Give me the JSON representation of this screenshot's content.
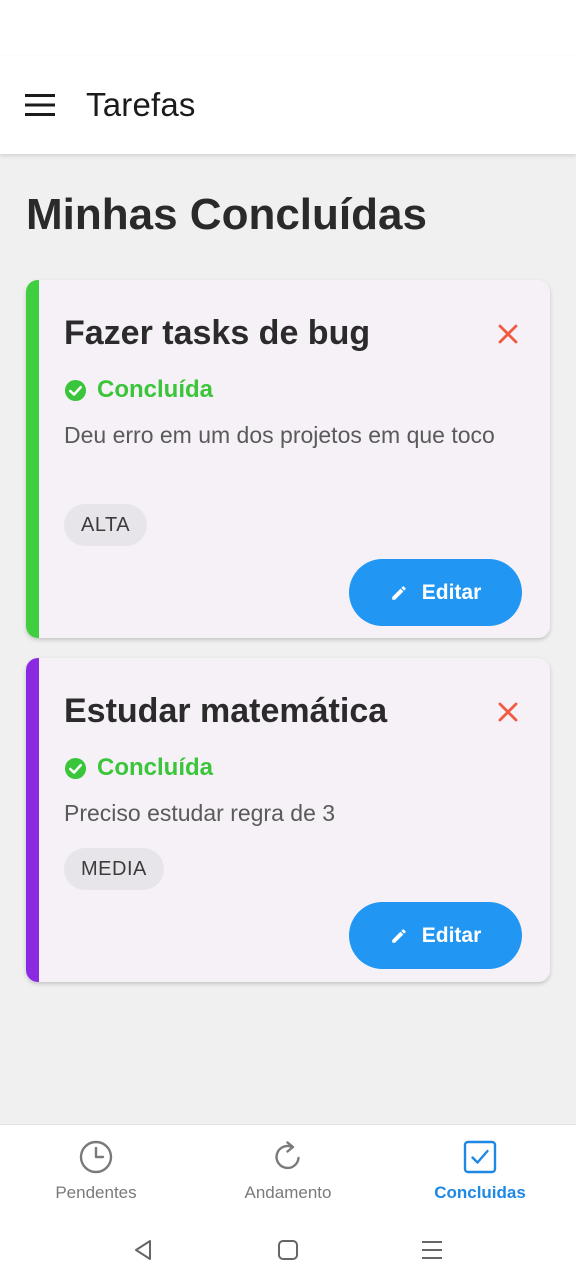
{
  "appbar": {
    "title": "Tarefas"
  },
  "page": {
    "title": "Minhas Concluídas"
  },
  "colors": {
    "primary": "#2196f3",
    "done": "#3ac53a",
    "close": "#f15a40",
    "accent_high": "#3fce3f",
    "accent_medium": "#8a2be2",
    "nav_active": "#1e88e5"
  },
  "tasks": [
    {
      "title": "Fazer tasks de bug",
      "status": "Concluída",
      "description": "Deu erro em um dos projetos em que toco",
      "priority": "ALTA",
      "edit_label": "Editar"
    },
    {
      "title": "Estudar matemática",
      "status": "Concluída",
      "description": "Preciso estudar regra de 3",
      "priority": "MEDIA",
      "edit_label": "Editar"
    }
  ],
  "bottom_nav": {
    "items": [
      {
        "label": "Pendentes",
        "icon": "clock-icon",
        "active": false
      },
      {
        "label": "Andamento",
        "icon": "refresh-icon",
        "active": false
      },
      {
        "label": "Concluidas",
        "icon": "checkbox-icon",
        "active": true
      }
    ]
  },
  "system_nav": {
    "icons": [
      "back-icon",
      "home-icon",
      "recents-icon"
    ]
  }
}
